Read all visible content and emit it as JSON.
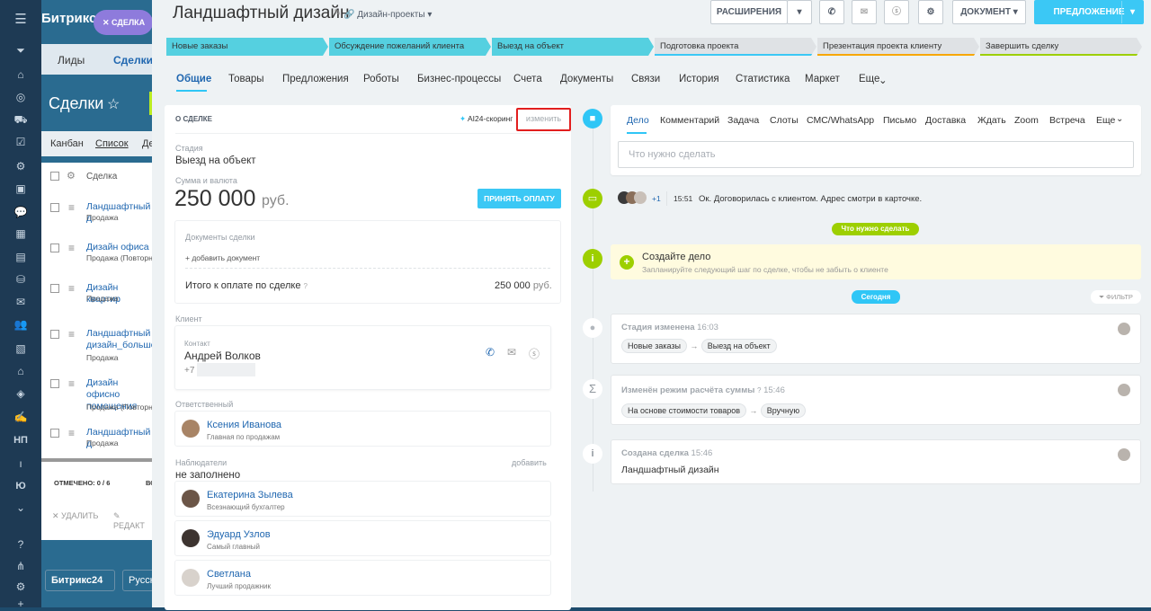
{
  "bg": {
    "brand": "Битрикс",
    "deal_chip": "СДЕЛКА",
    "tabs": [
      "Лиды",
      "Сделки"
    ],
    "page_title": "Сделки",
    "views": [
      "Канбан",
      "Список",
      "Де"
    ],
    "col_header": "Сделка",
    "rows": [
      {
        "title": "Ландшафтный д",
        "sub": "Продажа"
      },
      {
        "title": "Дизайн офиса",
        "sub": "Продажа (Повторн"
      },
      {
        "title": "Дизайн квартир",
        "sub": "Продажа"
      },
      {
        "title": "Ландшафтный дизайн_большо",
        "sub": "Продажа"
      },
      {
        "title": "Дизайн офисно помещения",
        "sub": "Продажа (Повторн"
      },
      {
        "title": "Ландшафтный д",
        "sub": "Продажа"
      }
    ],
    "marked": "ОТМЕЧЕНО: 0 / 6",
    "marked_extra": "ВС",
    "delete": "УДАЛИТЬ",
    "edit": "РЕДАКТ",
    "footer_brand": "Битрикс24",
    "footer_lang": "Русск",
    "np": "НП",
    "yu": "Ю"
  },
  "header": {
    "title": "Ландшафтный дизайн",
    "category": "Дизайн-проекты",
    "ext_btn": "РАСШИРЕНИЯ",
    "doc_btn": "ДОКУМЕНТ",
    "offer_btn": "ПРЕДЛОЖЕНИЕ"
  },
  "stages": [
    {
      "label": "Новые заказы",
      "color": "#55d0e0"
    },
    {
      "label": "Обсуждение пожеланий клиента",
      "color": "#55d0e0"
    },
    {
      "label": "Выезд на объект",
      "color": "#55d0e0"
    },
    {
      "label": "Подготовка проекта",
      "color": "#dfe2e5"
    },
    {
      "label": "Презентация проекта клиенту",
      "color": "#dfe2e5"
    },
    {
      "label": "Завершить сделку",
      "color": "#dfe2e5"
    }
  ],
  "tabs": [
    "Общие",
    "Товары",
    "Предложения",
    "Роботы",
    "Бизнес-процессы",
    "Счета",
    "Документы",
    "Связи",
    "История",
    "Статистика",
    "Маркет",
    "Еще"
  ],
  "left": {
    "section_title": "О СДЕЛКЕ",
    "ai_label": "AI24-скоринг",
    "edit_link": "изменить",
    "stage_label": "Стадия",
    "stage_value": "Выезд на объект",
    "sum_label": "Сумма и валюта",
    "sum_value": "250 000",
    "currency": "руб.",
    "pay_btn": "ПРИНЯТЬ ОПЛАТУ",
    "docs_label": "Документы сделки",
    "add_doc": "+ добавить документ",
    "total_label": "Итого к оплате по сделке",
    "total_value": "250 000",
    "total_currency": "руб.",
    "client_label": "Клиент",
    "contact_label": "Контакт",
    "contact_name": "Андрей Волков",
    "contact_phone": "+7",
    "resp_label": "Ответственный",
    "resp_name": "Ксения Иванова",
    "resp_pos": "Главная по продажам",
    "observers_label": "Наблюдатели",
    "add_link": "добавить",
    "not_filled": "не заполнено",
    "observers": [
      {
        "name": "Екатерина Зылева",
        "pos": "Всезнающий бухгалтер"
      },
      {
        "name": "Эдуард Узлов",
        "pos": "Самый главный"
      },
      {
        "name": "Светлана",
        "pos": "Лучший продажник"
      }
    ]
  },
  "timeline": {
    "tabs": [
      "Дело",
      "Комментарий",
      "Задача",
      "Слоты",
      "СМС/WhatsApp",
      "Письмо",
      "Доставка",
      "Ждать",
      "Zoom",
      "Встреча",
      "Еще"
    ],
    "todo_placeholder": "Что нужно сделать",
    "comment_count": "+1",
    "comment_time": "15:51",
    "comment_text": "Ок. Договорилась с клиентом. Адрес смотри в карточке.",
    "todo_badge": "Что нужно сделать",
    "create_title": "Создайте дело",
    "create_sub": "Запланируйте следующий шаг по сделке, чтобы не забыть о клиенте",
    "today_badge": "Сегодня",
    "filter": "ФИЛЬТР",
    "events": [
      {
        "title": "Стадия изменена",
        "time": "16:03",
        "from": "Новые заказы",
        "to": "Выезд на объект"
      },
      {
        "title": "Изменён режим расчёта суммы",
        "time": "15:46",
        "from": "На основе стоимости товаров",
        "to": "Вручную"
      },
      {
        "title": "Создана сделка",
        "time": "15:46",
        "text": "Ландшафтный дизайн"
      }
    ]
  }
}
